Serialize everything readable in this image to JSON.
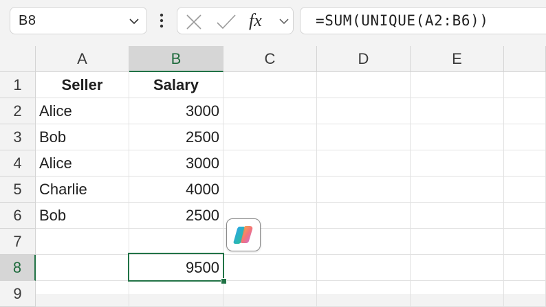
{
  "formula_bar": {
    "name_box": "B8",
    "fx_label": "fx",
    "formula": "=SUM(UNIQUE(A2:B6))"
  },
  "columns": [
    "A",
    "B",
    "C",
    "D",
    "E"
  ],
  "rows": [
    "1",
    "2",
    "3",
    "4",
    "5",
    "6",
    "7",
    "8",
    "9"
  ],
  "cells": {
    "A1": "Seller",
    "B1": "Salary",
    "A2": "Alice",
    "B2": "3000",
    "A3": "Bob",
    "B3": "2500",
    "A4": "Alice",
    "B4": "3000",
    "A5": "Charlie",
    "B5": "4000",
    "A6": "Bob",
    "B6": "2500",
    "B8": "9500"
  },
  "selected_cell": "B8",
  "icons": {
    "name_box_dropdown": "chevron-down-icon",
    "more": "vertical-ellipsis-icon",
    "cancel": "close-icon",
    "enter": "checkmark-icon",
    "fx_dropdown": "chevron-down-icon",
    "copilot": "copilot-icon"
  },
  "colors": {
    "accent": "#217346",
    "header_bg": "#f3f3f3",
    "selected_header_bg": "#d6d6d6"
  }
}
